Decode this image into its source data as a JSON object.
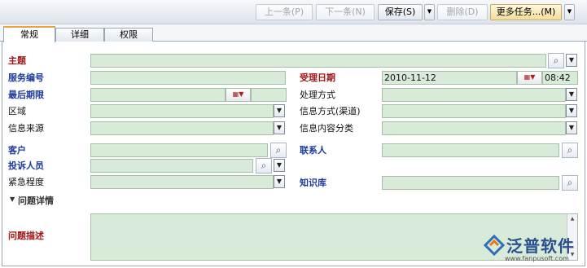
{
  "toolbar": {
    "prev_label": "上一条(P)",
    "next_label": "下一条(N)",
    "save_label": "保存(S)",
    "delete_label": "删除(D)",
    "more_label": "更多任务...(M)"
  },
  "tabs": [
    {
      "label": "常规",
      "active": true
    },
    {
      "label": "详细",
      "active": false
    },
    {
      "label": "权限",
      "active": false
    }
  ],
  "form": {
    "subject_label": "主题",
    "service_no_label": "服务编号",
    "accept_date_label": "受理日期",
    "accept_date_value": "2010-11-12",
    "accept_time_value": "08:42",
    "deadline_label": "最后期限",
    "handling_label": "处理方式",
    "region_label": "区域",
    "info_channel_label": "信息方式(渠道)",
    "info_source_label": "信息来源",
    "info_category_label": "信息内容分类",
    "customer_label": "客户",
    "contact_label": "联系人",
    "complainant_label": "投诉人员",
    "urgency_label": "紧急程度",
    "knowledge_label": "知识库",
    "details_section_label": "问题详情",
    "description_label": "问题描述"
  },
  "branding": {
    "logo_text": "泛普软件",
    "logo_url_text": "www.fanpusoft.com"
  },
  "icons": {
    "search": "magnifier-icon",
    "dropdown": "chevron-down-icon",
    "calendar": "calendar-icon"
  },
  "colors": {
    "field_bg": "#d8ebd8",
    "blue_label": "#1d3a9e",
    "red_label": "#a21515",
    "active_tab_accent": "#e8a33c"
  }
}
